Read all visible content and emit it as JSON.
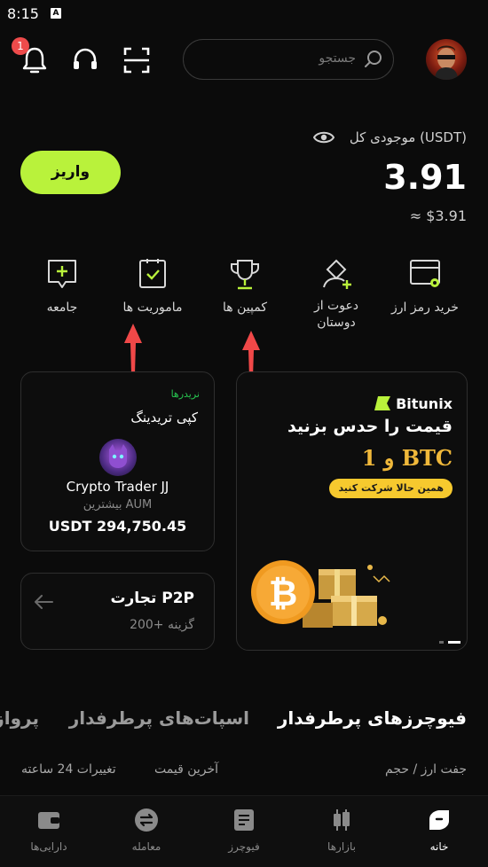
{
  "status_bar": {
    "time": "8:15",
    "indicator": "A"
  },
  "header": {
    "notification_count": "1",
    "search_placeholder": "جستجو"
  },
  "balance": {
    "label": "موجودی کل (USDT)",
    "value": "3.91",
    "usd_value": "≈ $3.91",
    "deposit_label": "واریز"
  },
  "quick_actions": [
    {
      "label": "خرید رمز ارز",
      "icon": "card-buy-icon"
    },
    {
      "label": "دعوت از\nدوستان",
      "icon": "invite-user-icon"
    },
    {
      "label": "کمپین ها",
      "icon": "trophy-icon"
    },
    {
      "label": "ماموریت ها",
      "icon": "mission-clipboard-icon"
    },
    {
      "label": "جامعه",
      "icon": "community-chat-icon"
    }
  ],
  "copy_trading": {
    "tag": "نریدرها",
    "title": "کپی تریدینگ",
    "trader_name": "Crypto Trader JJ",
    "aum_label": "بیشترین AUM",
    "aum_value": "USDT 294,750.45"
  },
  "p2p": {
    "title": "تجارت P2P",
    "subtitle": "200+ گزینه"
  },
  "banner": {
    "brand": "Bitunix",
    "headline": "قیمت را حدس بزنید",
    "prize": "و 1 BTC",
    "cta": "همین حالا شرکت کنید"
  },
  "market_tabs": [
    "فیوچرزهای پرطرفدار",
    "اسپات‌های پرطرفدار",
    "پرواز"
  ],
  "market_columns": {
    "pair": "جفت ارز / حجم",
    "price": "آخرین قیمت",
    "change": "تغییرات 24 ساعته"
  },
  "bottom_nav": [
    {
      "label": "خانه",
      "active": true
    },
    {
      "label": "بازارها",
      "active": false
    },
    {
      "label": "فیوچرز",
      "active": false
    },
    {
      "label": "معامله",
      "active": false
    },
    {
      "label": "دارایی‌ها",
      "active": false
    }
  ],
  "colors": {
    "accent": "#b9f23b",
    "background": "#0b0b0b",
    "annotation_arrow": "#f04848",
    "badge": "#ee4b4b"
  }
}
